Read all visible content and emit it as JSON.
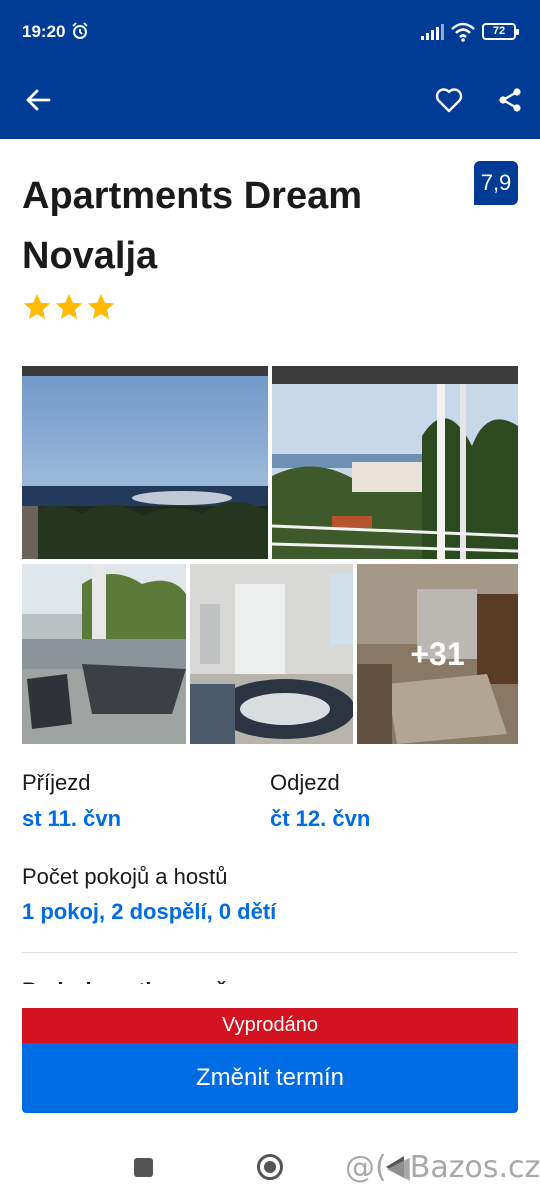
{
  "status_bar": {
    "time": "19:20",
    "battery": "72"
  },
  "header": {
    "back_icon": "arrow-left-icon",
    "favorite_icon": "heart-icon",
    "share_icon": "share-icon"
  },
  "property": {
    "name": "Apartments Dream Novalja",
    "review_score": "7,9",
    "stars": 3,
    "star_color": "#febb02"
  },
  "gallery": {
    "more_photos": "+31"
  },
  "dates": {
    "checkin_label": "Příjezd",
    "checkin_value": "st 11. čvn",
    "checkout_label": "Odjezd",
    "checkout_value": "čt 12. čvn"
  },
  "guests": {
    "label": "Počet pokojů a hostů",
    "value": "1 pokoj, 2 dospělí, 0 dětí"
  },
  "next_section_partial": "Podrobnosti o ceně",
  "footer": {
    "sold_out": "Vyprodáno",
    "change_dates_button": "Změnit termín"
  },
  "watermark": "@(◀Bazos.cz",
  "colors": {
    "brand": "#003b95",
    "link": "#006ce4",
    "sold_out": "#d4111e"
  }
}
